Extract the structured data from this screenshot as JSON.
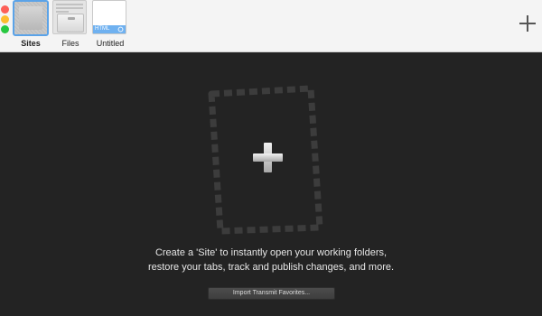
{
  "window": {
    "controls": [
      "close",
      "minimize",
      "zoom"
    ],
    "control_colors": {
      "close": "#fd5f57",
      "minimize": "#febc2e",
      "zoom": "#28c840"
    }
  },
  "toolbar": {
    "tabs": [
      {
        "label": "Sites",
        "icon": "sites-thumbnail",
        "selected": true
      },
      {
        "label": "Files",
        "icon": "file-browser-thumbnail",
        "selected": false
      },
      {
        "label": "Untitled",
        "icon": "html-document-thumbnail",
        "selected": false,
        "badge": "HTML"
      }
    ],
    "add_icon": "plus-icon",
    "accent_color": "#5ba3e8"
  },
  "main": {
    "dropzone_icon": "plus-icon",
    "description_line1": "Create a 'Site' to instantly open your working folders,",
    "description_line2": "restore your tabs, track and publish changes, and more.",
    "import_button_label": "Import Transmit Favorites..."
  }
}
